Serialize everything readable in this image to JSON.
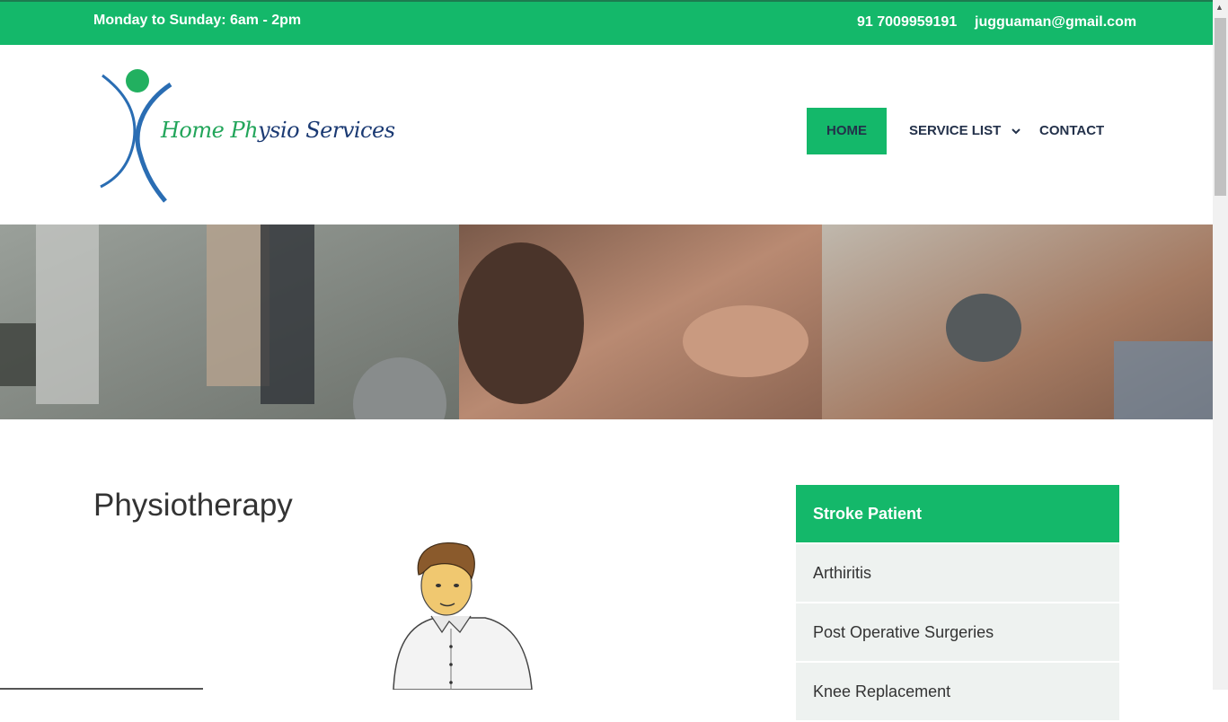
{
  "topbar": {
    "hours": "Monday to Sunday: 6am - 2pm",
    "phone": "91 7009959191",
    "email": "jugguaman@gmail.com"
  },
  "logo": {
    "text_home": "Home Ph",
    "text_rest": "ysio Services"
  },
  "nav": {
    "home": "HOME",
    "service_list": "SERVICE LIST",
    "contact": "CONTACT"
  },
  "main": {
    "title": "Physiotherapy"
  },
  "sidebar": {
    "items": [
      {
        "label": "Stroke Patient"
      },
      {
        "label": "Arthiritis"
      },
      {
        "label": "Post Operative Surgeries"
      },
      {
        "label": "Knee Replacement"
      }
    ]
  },
  "colors": {
    "accent": "#14b86a",
    "nav_text": "#23314a",
    "sidebar_bg": "#eef2f0"
  }
}
